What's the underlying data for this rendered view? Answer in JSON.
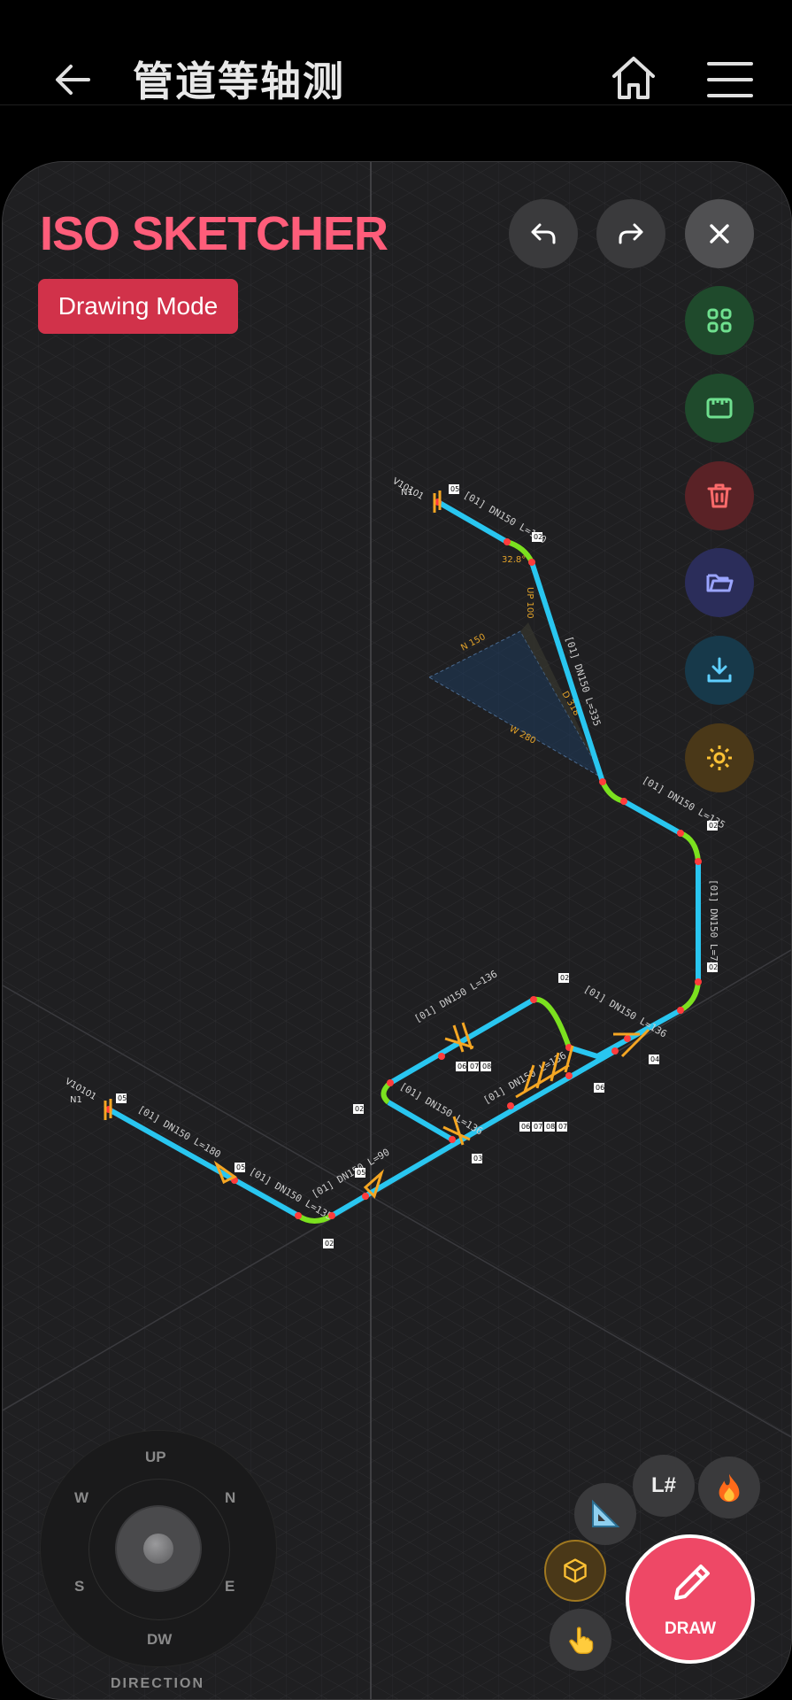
{
  "header": {
    "title": "管道等轴测",
    "back_icon": "arrow-left-icon",
    "home_icon": "home-icon",
    "menu_icon": "hamburger-menu-icon"
  },
  "canvas": {
    "brand": "ISO SKETCHER",
    "mode_label": "Drawing Mode",
    "colors": {
      "pipe": "#29c6f0",
      "bend": "#7be11f",
      "fitting": "#f5a623",
      "brand": "#ff5d7a",
      "mode_bg": "#d1324a",
      "draw_button": "#ee4866"
    }
  },
  "toolbar": {
    "undo_icon": "undo-icon",
    "redo_icon": "redo-icon",
    "close_icon": "close-icon",
    "side": [
      {
        "icon": "grid-icon",
        "color": "#1f4a2c"
      },
      {
        "icon": "ruler-icon",
        "color": "#1f4a2c"
      },
      {
        "icon": "trash-icon",
        "color": "#5a2226"
      },
      {
        "icon": "folder-icon",
        "color": "#2b2d5a"
      },
      {
        "icon": "download-icon",
        "color": "#17394a"
      },
      {
        "icon": "settings-icon",
        "color": "#4a3818"
      }
    ]
  },
  "sketch": {
    "line1": {
      "tag": "V10101",
      "node": "N1",
      "seg_labels": [
        "[01] DN150 L=170",
        "[01] DN150 L=335",
        "[01] DN150 L=135",
        "[01] DN150 L=725",
        "[01] DN150 L=136",
        "[01] DN150 L=136"
      ],
      "angle": "32.8°",
      "dims": [
        "N 150",
        "W 280",
        "D 318",
        "UP 100"
      ]
    },
    "line2": {
      "tag": "V10101",
      "node": "N1",
      "seg_labels": [
        "[01] DN150 L=180",
        "[01] DN150 L=135",
        "[01] DN150 L=90",
        "[01] DN150 L=136",
        "[01] DN150 L=136",
        "[01] DN150 L=136"
      ]
    },
    "badges": [
      "05",
      "02",
      "03",
      "04",
      "06",
      "07",
      "08"
    ]
  },
  "joystick": {
    "up": "UP",
    "down": "DW",
    "west": "W",
    "north": "N",
    "south": "S",
    "east": "E",
    "caption": "DIRECTION"
  },
  "tools": {
    "set_square_icon": "set-square-icon",
    "line_number": "L#",
    "fire_icon": "fire-icon",
    "cube_icon": "cube-icon",
    "hand_icon": "pointing-hand-icon",
    "draw_label": "DRAW",
    "draw_icon": "pencil-icon"
  }
}
